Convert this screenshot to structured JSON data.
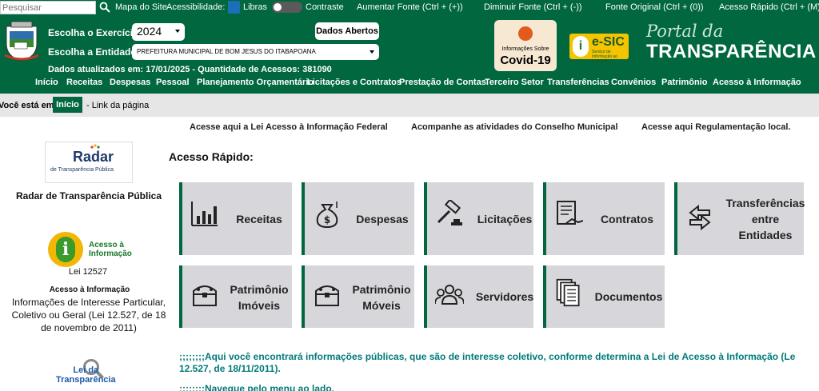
{
  "topbar": {
    "search_placeholder": "Pesquisar",
    "mapa": "Mapa do Site",
    "acessibilidade": "Acessibilidade:",
    "libras": "Libras",
    "contraste": "Contraste",
    "aumentar": "Aumentar Fonte (Ctrl + (+))",
    "diminuir": "Diminuir Fonte (Ctrl + (-))",
    "original": "Fonte Original (Ctrl + (0))",
    "rapido": "Acesso Rápido (Ctrl + (M))"
  },
  "header": {
    "exercicio_label": "Escolha o Exercício:",
    "exercicio_value": "2024",
    "entidade_label": "Escolha a Entidade:",
    "entidade_value": "PREFEITURA MUNICIPAL DE BOM JESUS DO ITABAPOANA",
    "dados_abertos": "Dados Abertos",
    "updated": "Dados atualizados em: 17/01/2025 - Quantidade de Acessos: 381090",
    "covid_small": "Informações Sobre",
    "covid_big": "Covid-19",
    "esic_title": "e-SIC",
    "esic_sub": "Serviço de Informação ao Cidadão",
    "portal_line1": "Portal da",
    "portal_line2": "TRANSPARÊNCIA"
  },
  "nav": [
    "Início",
    "Receitas",
    "Despesas",
    "Pessoal",
    "Planejamento Orçamentário",
    "Licitações e Contratos",
    "Prestação de Contas",
    "Terceiro Setor",
    "Transferências",
    "Convênios",
    "Patrimônio",
    "Acesso à Informação"
  ],
  "breadcrumb": {
    "you_are": "Você está em:",
    "inicio": "Início",
    "page": "- Link da página"
  },
  "links": [
    "Acesse aqui a Lei Acesso à Informação Federal",
    "Acompanhe as atividades do Conselho Municipal",
    "Acesse aqui Regulamentação local."
  ],
  "sidebar": {
    "radar_word": "Radar",
    "radar_sub": "de Transparência Pública",
    "radar_label": "Radar de Transparência Pública",
    "acesso_line1": "Acesso à",
    "acesso_line2": "Informação",
    "lei_num": "Lei 12527",
    "acesso_title": "Acesso à Informação",
    "acesso_desc": "Informações de Interesse Particular, Coletivo ou Geral (Lei 12.527, de 18 de novembro de 2011)",
    "lei_line1": "Lei da",
    "lei_line2": "Transparência"
  },
  "quick": {
    "title": "Acesso Rápido:",
    "tiles": [
      {
        "label": "Receitas",
        "icon": "bar-chart-icon"
      },
      {
        "label": "Despesas",
        "icon": "money-bag-icon"
      },
      {
        "label": "Licitações",
        "icon": "gavel-icon"
      },
      {
        "label": "Contratos",
        "icon": "contract-handshake-icon"
      },
      {
        "label": "Transferências entre Entidades",
        "icon": "transfer-arrows-icon"
      },
      {
        "label": "Patrimônio Imóveis",
        "icon": "treasure-chest-icon"
      },
      {
        "label": "Patrimônio Móveis",
        "icon": "treasure-chest-icon"
      },
      {
        "label": "Servidores",
        "icon": "people-icon"
      },
      {
        "label": "Documentos",
        "icon": "documents-icon"
      }
    ]
  },
  "intro": {
    "line1": ";;;;;;;;Aqui você encontrará informações públicas, que são de interesse coletivo, conforme determina a Lei de Acesso à Informação (Le",
    "line2": "12.527, de 18/11/2011).",
    "line3": ";;;;;;;;Navegue pelo menu ao lado."
  },
  "colors": {
    "brand": "#00673f",
    "tile": "#d7d7db",
    "intro": "#007a7a"
  }
}
